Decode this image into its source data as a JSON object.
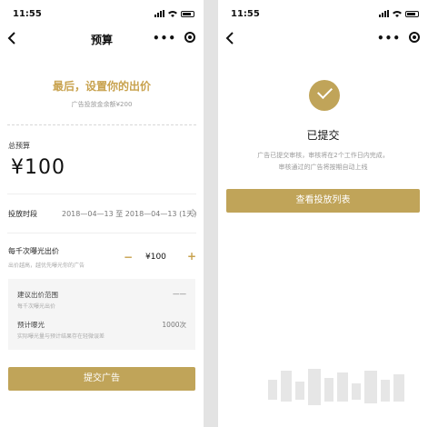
{
  "left_screen": {
    "status": {
      "time": "11:55"
    },
    "nav": {
      "title": "预算"
    },
    "headline": "最后，设置你的出价",
    "balance_text": "广告投放金余额¥200",
    "budget": {
      "label": "总预算",
      "amount": "¥100"
    },
    "period": {
      "label": "投放时段",
      "value": "2018—04—13 至 2018—04—13 (1天)"
    },
    "bid": {
      "label": "每千次曝光出价",
      "hint": "出价越高，越优先曝光你的广告",
      "minus": "−",
      "value": "¥100",
      "plus": "+"
    },
    "suggest": {
      "label": "建议出价范围",
      "hint": "每千次曝光出价",
      "value": "——"
    },
    "exposure": {
      "label": "预计曝光",
      "hint": "实际曝光量与预计结果存在轻微误差",
      "value": "1000次"
    },
    "submit_label": "提交广告"
  },
  "right_screen": {
    "status": {
      "time": "11:55"
    },
    "title": "已提交",
    "desc_line1": "广告已提交审核，审核将在2个工作日内完成，",
    "desc_line2": "审核通过的广告将按期自动上线",
    "view_button_label": "查看投放列表"
  },
  "colors": {
    "accent": "#c0a459",
    "headline": "#c8a24e"
  }
}
